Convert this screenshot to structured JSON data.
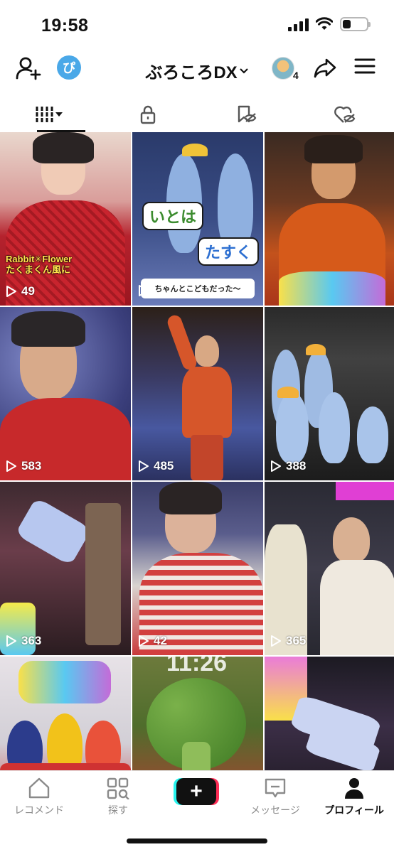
{
  "status_bar": {
    "time": "19:58"
  },
  "header": {
    "title": "ぶろころDX",
    "friend_count": "4",
    "logo_glyph": "ぴ"
  },
  "tabs": [
    {
      "name": "videos",
      "icon": "grid-filter-icon"
    },
    {
      "name": "private",
      "icon": "lock-icon"
    },
    {
      "name": "saved",
      "icon": "bookmark-hidden-icon"
    },
    {
      "name": "liked",
      "icon": "heart-hidden-icon"
    }
  ],
  "videos": [
    {
      "count": "49",
      "caption_line1": "Rabbit✳Flower",
      "caption_line2": "たくまくん風に"
    },
    {
      "count": "",
      "sticker1": "いとは",
      "sticker2": "たすく",
      "banner": "ちゃんとこどもだった〜"
    },
    {
      "count": ""
    },
    {
      "count": "583"
    },
    {
      "count": "485"
    },
    {
      "count": "388"
    },
    {
      "count": "363"
    },
    {
      "count": "42"
    },
    {
      "count": "365"
    },
    {
      "count": ""
    },
    {
      "count": "",
      "clock": "11:26"
    },
    {
      "count": ""
    }
  ],
  "bottom_nav": {
    "items": [
      {
        "label": "レコメンド",
        "icon": "home-icon"
      },
      {
        "label": "探す",
        "icon": "discover-icon"
      },
      {
        "label": "",
        "icon": "plus-icon"
      },
      {
        "label": "メッセージ",
        "icon": "inbox-icon"
      },
      {
        "label": "プロフィール",
        "icon": "profile-icon"
      }
    ]
  },
  "colors": {
    "accent_cyan": "#27f4ee",
    "accent_red": "#fe2c55"
  }
}
